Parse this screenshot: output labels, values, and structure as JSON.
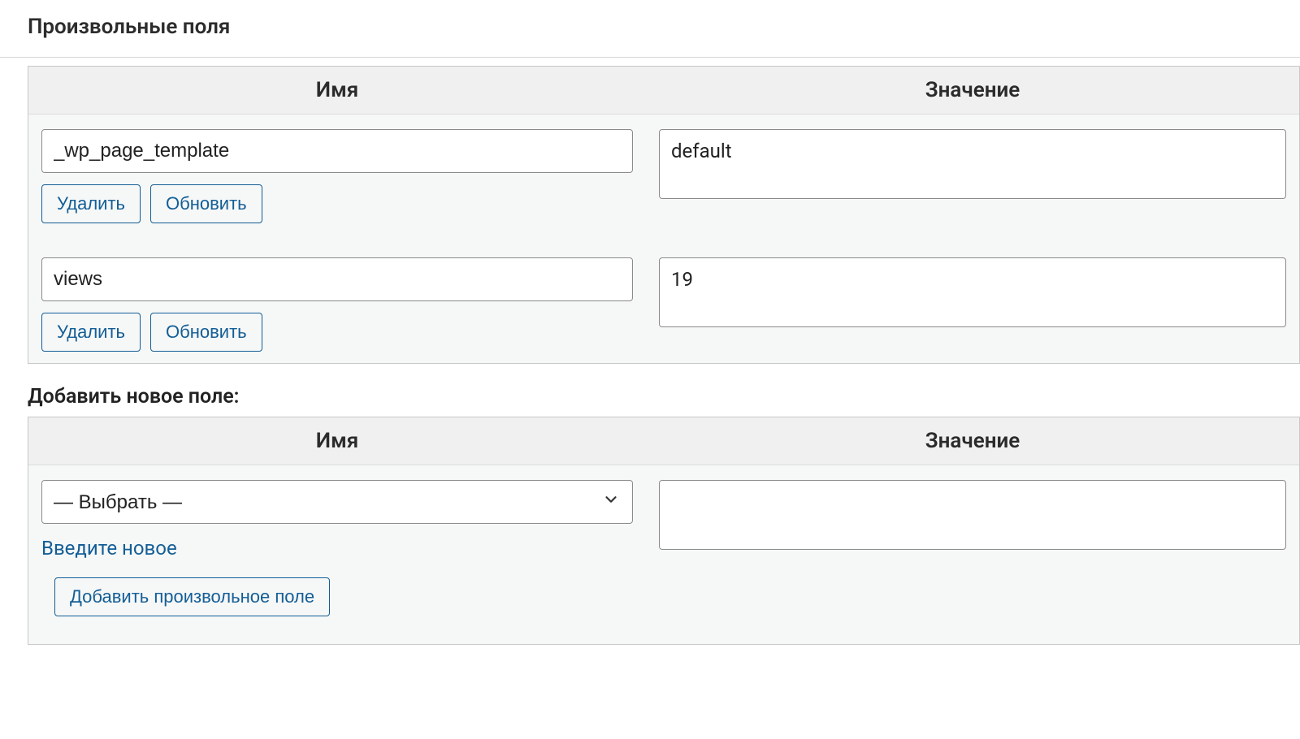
{
  "panel": {
    "title": "Произвольные поля"
  },
  "table": {
    "headers": {
      "name": "Имя",
      "value": "Значение"
    },
    "rows": [
      {
        "name": "_wp_page_template",
        "value": "default"
      },
      {
        "name": "views",
        "value": "19"
      }
    ],
    "row_actions": {
      "delete": "Удалить",
      "update": "Обновить"
    }
  },
  "add_new": {
    "heading": "Добавить новое поле:",
    "headers": {
      "name": "Имя",
      "value": "Значение"
    },
    "select_placeholder": "— Выбрать —",
    "enter_new": "Введите новое",
    "add_button": "Добавить произвольное поле",
    "value": ""
  },
  "colors": {
    "link": "#135e96",
    "border": "#8a8a8a",
    "panel_bg": "#f6f7f7",
    "header_bg": "#f0f0f1"
  }
}
